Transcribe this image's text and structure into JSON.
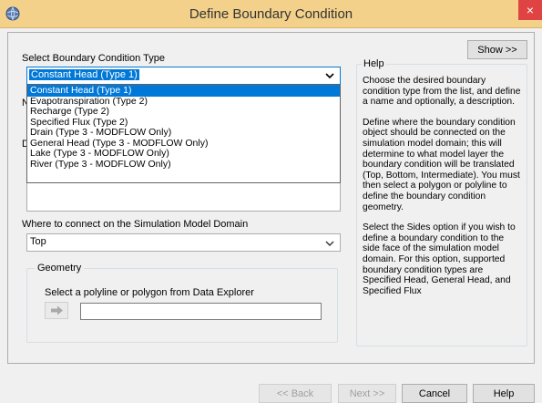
{
  "window": {
    "title": "Define Boundary Condition",
    "close_glyph": "×"
  },
  "type_section": {
    "label": "Select Boundary Condition Type",
    "selected": "Constant Head (Type 1)",
    "options": [
      "Constant Head (Type 1)",
      "Evapotranspiration (Type 2)",
      "Recharge (Type 2)",
      "Specified Flux (Type 2)",
      "Drain (Type 3 - MODFLOW Only)",
      "General Head (Type 3 - MODFLOW Only)",
      "Lake (Type 3 - MODFLOW Only)",
      "River (Type 3 - MODFLOW Only)"
    ],
    "name_label_partial": "N",
    "desc_label_partial": "D"
  },
  "show_button": "Show >>",
  "connect_section": {
    "label": "Where to connect on the Simulation Model Domain",
    "selected": "Top"
  },
  "geometry": {
    "title": "Geometry",
    "instruction": "Select a polyline or polygon from Data Explorer",
    "value": ""
  },
  "help": {
    "title": "Help",
    "paragraphs": [
      "Choose the desired boundary condition type from the list, and define a name and optionally, a description.",
      "Define where the boundary condition object should be connected on the simulation model domain; this will determine to what model layer the boundary condition will be translated (Top, Bottom, Intermediate).  You must then select a polygon or polyline to define the boundary condition geometry.",
      "Select the Sides option if you wish to define a boundary condition to the side face of the simulation model domain.  For this option, supported boundary condition types are Specified Head, General Head, and Specified Flux"
    ]
  },
  "footer": {
    "back": "<< Back",
    "next": "Next >>",
    "cancel": "Cancel",
    "help": "Help"
  },
  "icons": {
    "app": "globe-icon",
    "close": "close-icon",
    "dropdown": "chevron-down-icon",
    "select_arrow": "right-arrow-icon"
  },
  "colors": {
    "titlebar": "#f3d18a",
    "close": "#e04343",
    "selection": "#0078d7"
  }
}
